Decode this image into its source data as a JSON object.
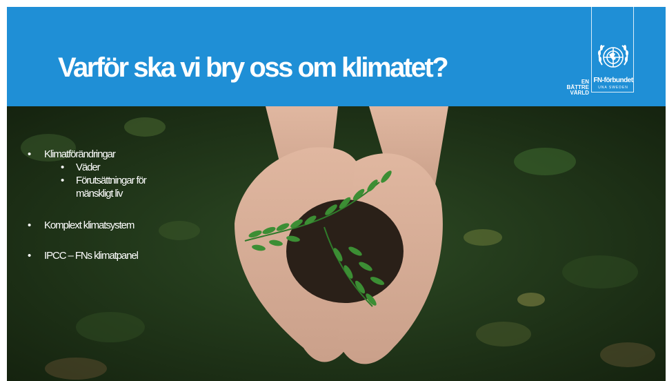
{
  "slide": {
    "title": "Varför ska vi bry oss om klimatet?",
    "logo": {
      "tagline": [
        "EN",
        "BÄTTRE",
        "VÄRLD"
      ],
      "name": "FN-förbundet",
      "subtitle": "UNA SWEDEN",
      "emblem_icon": "un-emblem-icon"
    },
    "bullets": {
      "b1": "Klimatförändringar",
      "b1_sub1": "Väder",
      "b1_sub2_line1": "Förutsättningar för",
      "b1_sub2_line2": "mänskligt liv",
      "b2": "Komplext klimatsystem",
      "b3": "IPCC – FNs klimatpanel",
      "marker": "•"
    },
    "image": "hands-holding-soil-with-seedling"
  },
  "colors": {
    "header": "#1f8fd6",
    "title_text": "#ffffff",
    "foliage": "#1e3418"
  }
}
